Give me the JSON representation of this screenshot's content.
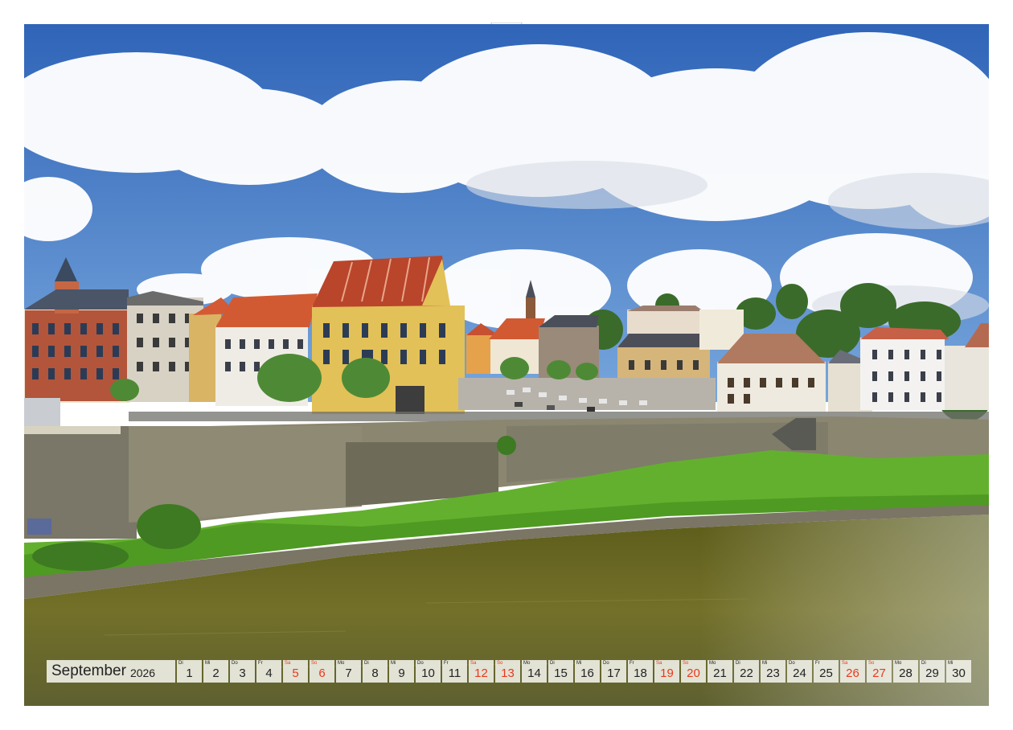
{
  "calendar": {
    "month": "September",
    "year": "2026",
    "days": [
      {
        "wd": "Di",
        "d": "1",
        "we": false
      },
      {
        "wd": "Mi",
        "d": "2",
        "we": false
      },
      {
        "wd": "Do",
        "d": "3",
        "we": false
      },
      {
        "wd": "Fr",
        "d": "4",
        "we": false
      },
      {
        "wd": "Sa",
        "d": "5",
        "we": true
      },
      {
        "wd": "So",
        "d": "6",
        "we": true
      },
      {
        "wd": "Mo",
        "d": "7",
        "we": false
      },
      {
        "wd": "Di",
        "d": "8",
        "we": false
      },
      {
        "wd": "Mi",
        "d": "9",
        "we": false
      },
      {
        "wd": "Do",
        "d": "10",
        "we": false
      },
      {
        "wd": "Fr",
        "d": "11",
        "we": false
      },
      {
        "wd": "Sa",
        "d": "12",
        "we": true
      },
      {
        "wd": "So",
        "d": "13",
        "we": true
      },
      {
        "wd": "Mo",
        "d": "14",
        "we": false
      },
      {
        "wd": "Di",
        "d": "15",
        "we": false
      },
      {
        "wd": "Mi",
        "d": "16",
        "we": false
      },
      {
        "wd": "Do",
        "d": "17",
        "we": false
      },
      {
        "wd": "Fr",
        "d": "18",
        "we": false
      },
      {
        "wd": "Sa",
        "d": "19",
        "we": true
      },
      {
        "wd": "So",
        "d": "20",
        "we": true
      },
      {
        "wd": "Mo",
        "d": "21",
        "we": false
      },
      {
        "wd": "Di",
        "d": "22",
        "we": false
      },
      {
        "wd": "Mi",
        "d": "23",
        "we": false
      },
      {
        "wd": "Do",
        "d": "24",
        "we": false
      },
      {
        "wd": "Fr",
        "d": "25",
        "we": false
      },
      {
        "wd": "Sa",
        "d": "26",
        "we": true
      },
      {
        "wd": "So",
        "d": "27",
        "we": true
      },
      {
        "wd": "Mo",
        "d": "28",
        "we": false
      },
      {
        "wd": "Di",
        "d": "29",
        "we": false
      },
      {
        "wd": "Mi",
        "d": "30",
        "we": false
      }
    ]
  },
  "colors": {
    "weekend": "#e8391d",
    "sky": "#3f78c8",
    "river": "#6e6a1f",
    "grass": "#5fae2c"
  }
}
